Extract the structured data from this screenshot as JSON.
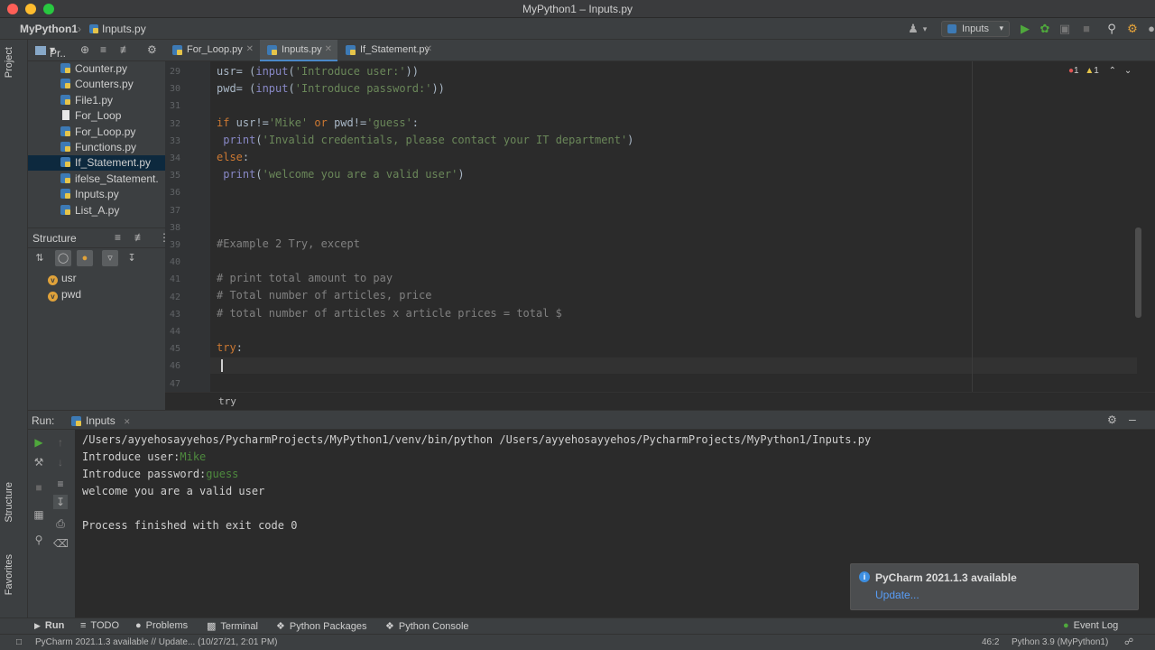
{
  "window": {
    "title": "MyPython1 – Inputs.py"
  },
  "nav": {
    "project": "MyPython1",
    "file": "Inputs.py",
    "run_config": "Inputs"
  },
  "side_labels": {
    "project": "Project",
    "structure": "Structure",
    "favorites": "Favorites"
  },
  "project_panel": {
    "title": "Pr..",
    "files": [
      {
        "name": "Counter.py",
        "icon": "python-file-icon"
      },
      {
        "name": "Counters.py",
        "icon": "python-file-icon"
      },
      {
        "name": "File1.py",
        "icon": "python-file-icon"
      },
      {
        "name": "For_Loop",
        "icon": "text-file-icon"
      },
      {
        "name": "For_Loop.py",
        "icon": "python-file-icon"
      },
      {
        "name": "Functions.py",
        "icon": "python-file-icon"
      },
      {
        "name": "If_Statement.py",
        "icon": "python-file-icon",
        "selected": true
      },
      {
        "name": "ifelse_Statement.",
        "icon": "python-file-icon"
      },
      {
        "name": "Inputs.py",
        "icon": "python-file-icon"
      },
      {
        "name": "List_A.py",
        "icon": "python-file-icon"
      }
    ]
  },
  "structure_panel": {
    "title": "Structure",
    "items": [
      {
        "name": "usr",
        "badge": "v"
      },
      {
        "name": "pwd",
        "badge": "v"
      }
    ]
  },
  "tabs": [
    {
      "label": "For_Loop.py",
      "active": false
    },
    {
      "label": "Inputs.py",
      "active": true
    },
    {
      "label": "If_Statement.py",
      "active": false
    }
  ],
  "inspection": {
    "errors": "1",
    "warnings": "1"
  },
  "editor": {
    "line_numbers": [
      "29",
      "30",
      "31",
      "32",
      "33",
      "34",
      "35",
      "36",
      "37",
      "38",
      "39",
      "40",
      "41",
      "42",
      "43",
      "44",
      "45",
      "46",
      "47"
    ],
    "breadcrumb": "try"
  },
  "run_panel": {
    "label": "Run:",
    "tab": "Inputs",
    "console": {
      "command": "/Users/ayyehosayyehos/PycharmProjects/MyPython1/venv/bin/python /Users/ayyehosayyehos/PycharmProjects/MyPython1/Inputs.py",
      "prompt_user": "Introduce user:",
      "input_user": "Mike",
      "prompt_password": "Introduce password:",
      "input_password": "guess",
      "output": "welcome you are a valid user",
      "exit": "Process finished with exit code 0"
    }
  },
  "notification": {
    "title": "PyCharm 2021.1.3 available",
    "link": "Update..."
  },
  "bottom_tools": [
    {
      "label": "Run",
      "icon": "play-icon"
    },
    {
      "label": "TODO",
      "icon": "list-icon"
    },
    {
      "label": "Problems",
      "icon": "problems-icon"
    },
    {
      "label": "Terminal",
      "icon": "terminal-icon"
    },
    {
      "label": "Python Packages",
      "icon": "packages-icon"
    },
    {
      "label": "Python Console",
      "icon": "console-icon"
    }
  ],
  "event_log": "Event Log",
  "status": {
    "message": "PyCharm 2021.1.3 available // Update... (10/27/21, 2:01 PM)",
    "position": "46:2",
    "interpreter": "Python 3.9 (MyPython1)"
  }
}
